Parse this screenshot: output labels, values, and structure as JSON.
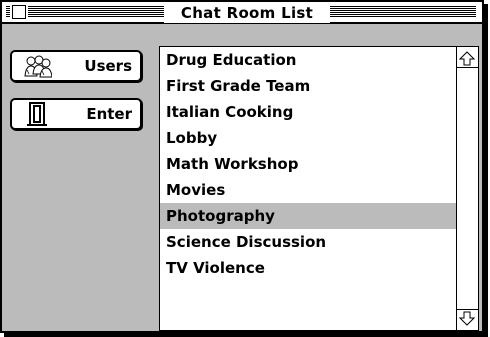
{
  "window": {
    "title": "Chat Room List"
  },
  "sidebar": {
    "users_label": "Users",
    "enter_label": "Enter"
  },
  "rooms": [
    "Drug Education",
    "First Grade Team",
    "Italian Cooking",
    "Lobby",
    "Math Workshop",
    "Movies",
    "Photography",
    "Science Discussion",
    "TV Violence"
  ],
  "selected_room": "Photography",
  "icons": {
    "close": "close-box-icon",
    "users": "users-icon",
    "enter": "door-icon",
    "scroll_up": "up-arrow-icon",
    "scroll_down": "down-arrow-icon"
  },
  "colors": {
    "window_bg": "#bbbbbb",
    "selection": "#bbbbbb",
    "list_bg": "#ffffff"
  }
}
